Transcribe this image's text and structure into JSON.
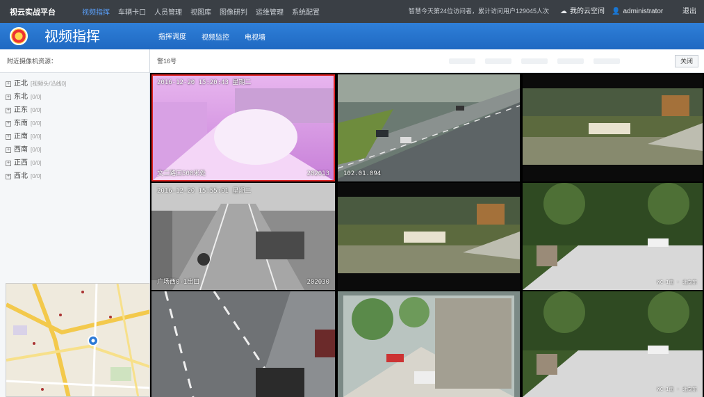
{
  "topbar": {
    "brand": "视云实战平台",
    "nav": [
      "视频指挥",
      "车辆卡口",
      "人员管理",
      "视图库",
      "图像研判",
      "运维管理",
      "系统配置"
    ],
    "stats": "智慧今天第24位访问者，累计访问用户129045人次",
    "cloud": "我的云空间",
    "user": "administrator",
    "logout": "退出"
  },
  "header": {
    "title": "视频指挥",
    "tabs": [
      "指挥调度",
      "视频监控",
      "电视墙"
    ]
  },
  "left": {
    "label": "附近摄像机资源：",
    "tree": [
      {
        "name": "正北",
        "count": "[视频头/沿线0]"
      },
      {
        "name": "东北",
        "count": "[0/0]"
      },
      {
        "name": "正东",
        "count": "[0/0]"
      },
      {
        "name": "东南",
        "count": "[0/0]"
      },
      {
        "name": "正南",
        "count": "[0/0]"
      },
      {
        "name": "西南",
        "count": "[0/0]"
      },
      {
        "name": "正西",
        "count": "[0/0]"
      },
      {
        "name": "西北",
        "count": "[0/0]"
      }
    ]
  },
  "main": {
    "label": "警16号",
    "close": "关闭"
  },
  "videos": [
    {
      "top": "2016-12-20 15:20:43  星期二",
      "bottom_left": "文二路口500米处",
      "bottom_right": "202013"
    },
    {
      "top": "",
      "bottom_left": "102.01.094",
      "bottom_right": ""
    },
    {
      "top": "",
      "bottom_left": "",
      "bottom_right": ""
    },
    {
      "top": "2016-12-20 15:55:01  星期二",
      "bottom_left": "广场西0-1出口",
      "bottom_right": "202030"
    },
    {
      "top": "",
      "bottom_left": "",
      "bottom_right": ""
    },
    {
      "top": "",
      "bottom_left": "",
      "bottom_right": "WC-1南 · 北向东"
    },
    {
      "top": "",
      "bottom_left": "",
      "bottom_right": ""
    },
    {
      "top": "",
      "bottom_left": "",
      "bottom_right": ""
    },
    {
      "top": "",
      "bottom_left": "",
      "bottom_right": "WC-1南 · 北向东"
    }
  ],
  "colors": {
    "topbar": "#3a3f45",
    "header": "#1f69c2",
    "selected": "#dd2222"
  }
}
